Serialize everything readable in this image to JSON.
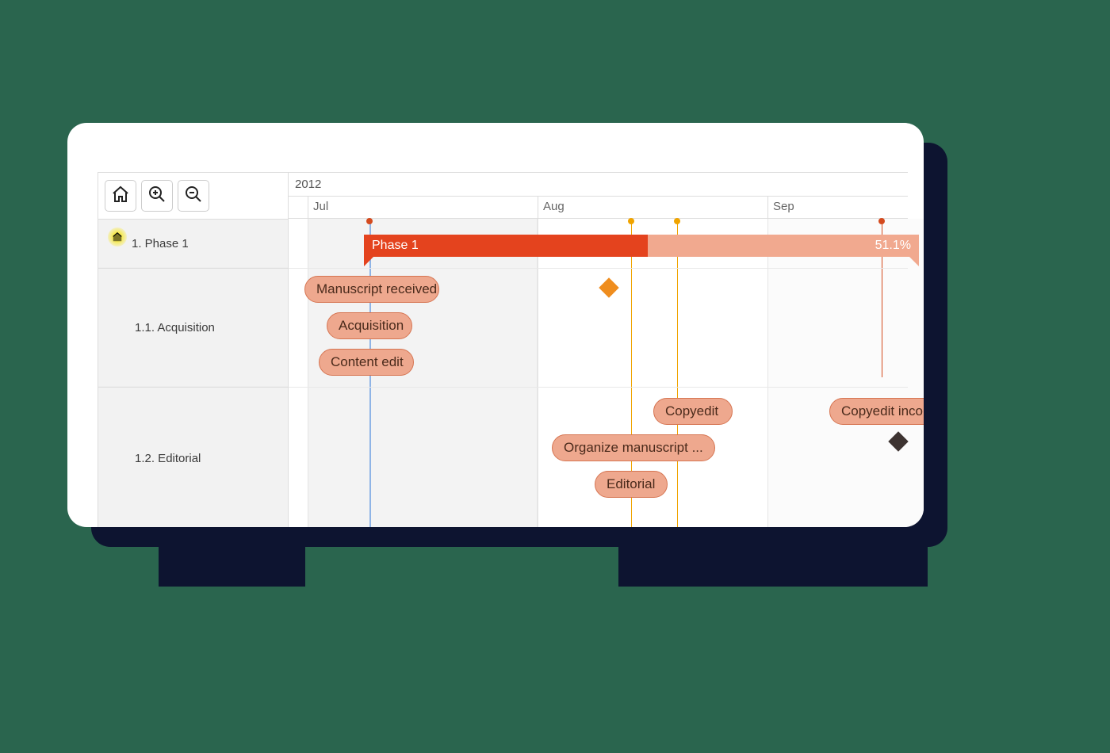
{
  "toolbar": {
    "home": "home-icon",
    "zoom_in": "zoom-in-icon",
    "zoom_out": "zoom-out-icon"
  },
  "year": "2012",
  "months": [
    "Jul",
    "Aug",
    "Sep"
  ],
  "rows": [
    {
      "label": "1. Phase 1"
    },
    {
      "label": "1.1. Acquisition"
    },
    {
      "label": "1.2. Editorial"
    }
  ],
  "summary": {
    "label": "Phase 1",
    "progress_text": "51.1%"
  },
  "tasks": {
    "manuscript": "Manuscript received",
    "acquisition": "Acquisition",
    "content_edit": "Content edit",
    "copyedit": "Copyedit",
    "copyedit_incorp": "Copyedit incorp",
    "organize": "Organize manuscript ...",
    "editorial": "Editorial"
  },
  "chart_data": {
    "type": "gantt",
    "title": "",
    "year": 2012,
    "time_axis": {
      "start": "2012-06-22",
      "end": "2012-09-20",
      "ticks": [
        "Jul",
        "Aug",
        "Sep"
      ]
    },
    "today_marker": "2012-07-05",
    "vertical_markers": [
      {
        "date": "2012-08-13",
        "color": "#f0a400"
      },
      {
        "date": "2012-08-19",
        "color": "#f0a400"
      },
      {
        "date": "2012-09-14",
        "color": "#d44a1e"
      }
    ],
    "rows": [
      {
        "id": "1",
        "label": "1. Phase 1",
        "type": "summary",
        "start": "2012-07-05",
        "end": "2012-09-22",
        "progress_pct": 51.1
      },
      {
        "id": "1.1",
        "label": "1.1. Acquisition",
        "type": "group",
        "tasks": [
          {
            "name": "Manuscript received",
            "start": "2012-06-27",
            "end": "2012-07-12"
          },
          {
            "name": "Acquisition",
            "start": "2012-07-01",
            "end": "2012-07-11"
          },
          {
            "name": "Content edit",
            "start": "2012-06-30",
            "end": "2012-07-11"
          }
        ],
        "milestones": [
          {
            "name": "milestone-orange",
            "date": "2012-08-11",
            "color": "#ef8d1e"
          }
        ]
      },
      {
        "id": "1.2",
        "label": "1.2. Editorial",
        "type": "group",
        "tasks": [
          {
            "name": "Copyedit",
            "start": "2012-08-16",
            "end": "2012-08-24"
          },
          {
            "name": "Copyedit incorp",
            "start": "2012-09-08",
            "end": "2012-09-22"
          },
          {
            "name": "Organize manuscript ...",
            "start": "2012-08-04",
            "end": "2012-08-24"
          },
          {
            "name": "Editorial",
            "start": "2012-08-10",
            "end": "2012-08-17"
          }
        ],
        "milestones": [
          {
            "name": "milestone-dark",
            "date": "2012-09-16",
            "color": "#3d3331"
          }
        ]
      }
    ]
  }
}
